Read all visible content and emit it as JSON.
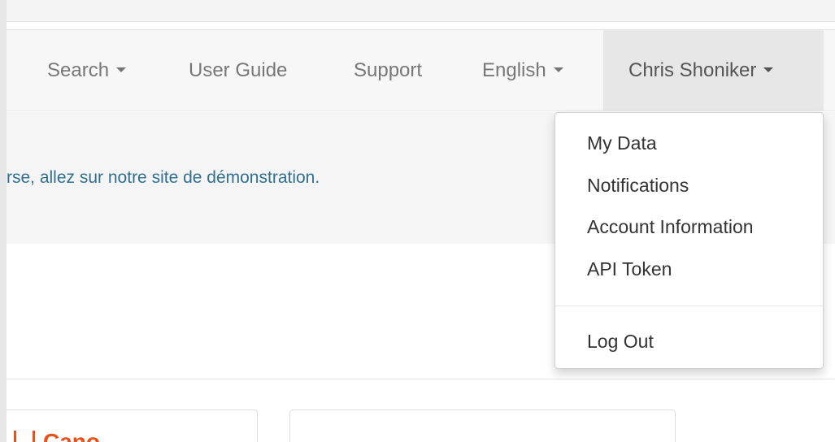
{
  "navbar": {
    "search_label": "Search",
    "user_guide_label": "User Guide",
    "support_label": "Support",
    "language_label": "English",
    "user_label": "Chris Shoniker"
  },
  "banner": {
    "text": "rse, allez sur notre site de démonstration."
  },
  "cards": {
    "left_title": "Cano"
  },
  "user_menu": {
    "items": [
      {
        "label": "My Data"
      },
      {
        "label": "Notifications"
      },
      {
        "label": "Account Information"
      },
      {
        "label": "API Token"
      }
    ],
    "logout_label": "Log Out"
  },
  "colors": {
    "link": "#31708f",
    "accent": "#e8501c",
    "navbar_bg": "#f7f7f7",
    "active_bg": "#e7e7e7"
  }
}
